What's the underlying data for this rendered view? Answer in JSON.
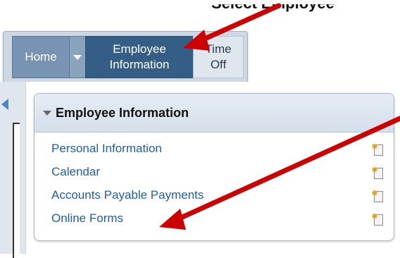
{
  "caption": "Select Employee",
  "tabs": {
    "home": "Home",
    "employee_info_line1": "Employee",
    "employee_info_line2": "Information",
    "time_off_line1": "Time",
    "time_off_line2": "Off"
  },
  "panel": {
    "title": "Employee Information",
    "items": [
      {
        "label": "Personal Information"
      },
      {
        "label": "Calendar"
      },
      {
        "label": "Accounts Payable Payments"
      },
      {
        "label": "Online Forms"
      }
    ]
  },
  "colors": {
    "accent": "#355e87",
    "link": "#1f5fa8",
    "annotation_arrow": "#cc0000"
  },
  "icons": [
    "caret-down-icon",
    "left-arrow-icon",
    "add-favorite-icon"
  ]
}
